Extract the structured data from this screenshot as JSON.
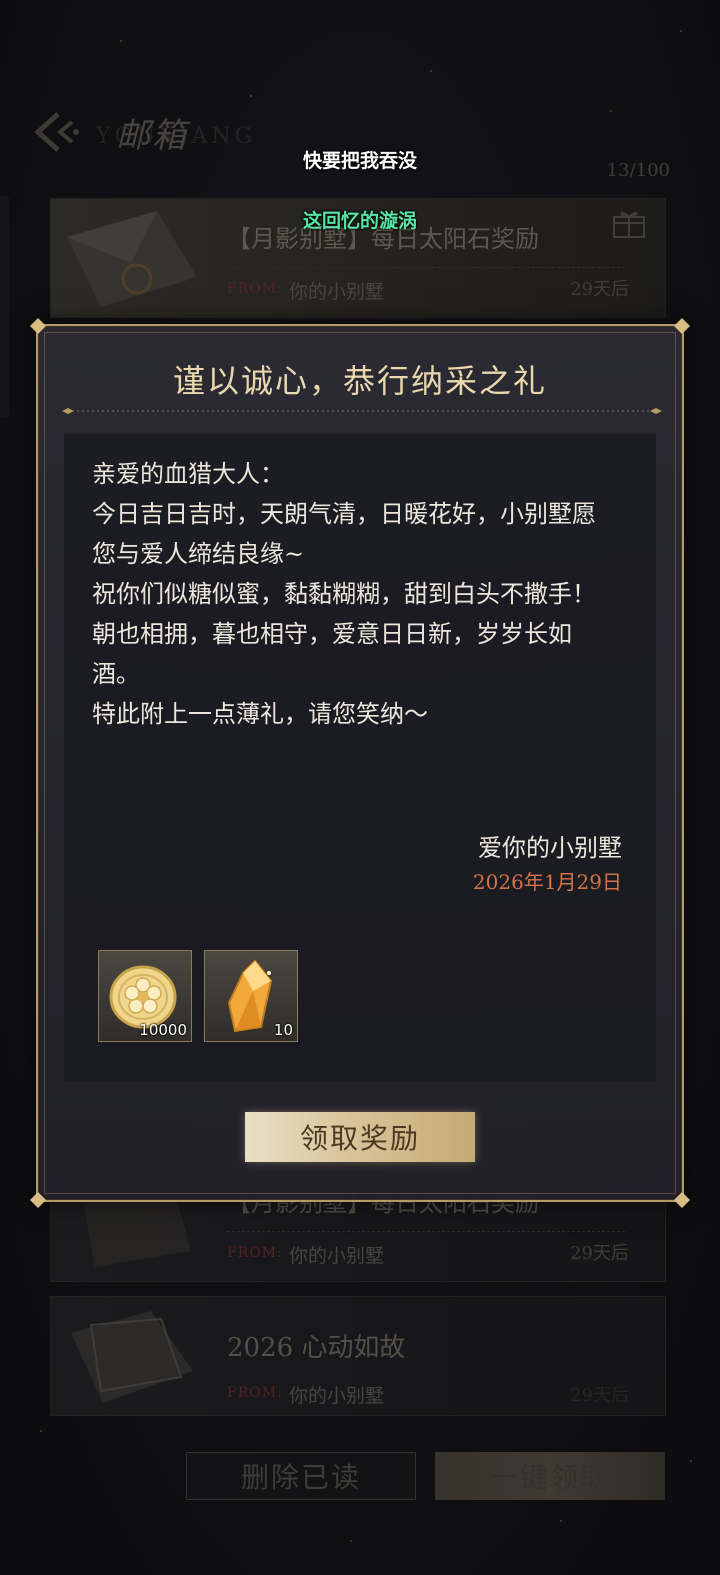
{
  "header": {
    "title": "邮箱",
    "title_en": "YOUXIANG",
    "mail_count": "13/100"
  },
  "toast": {
    "line1": "快要把我吞没",
    "line2": "这回忆的漩涡"
  },
  "mail_list": [
    {
      "title": "【月影别墅】每日太阳石奖励",
      "from_label": "FROM:",
      "from": "你的小别墅",
      "expire": "29天后"
    },
    {
      "title": "【月影别墅】每日太阳石奖励",
      "from_label": "FROM:",
      "from": "你的小别墅",
      "expire": "29天后"
    },
    {
      "title": "2026 心动如故",
      "from_label": "FROM:",
      "from": "你的小别墅",
      "expire": "29天后"
    }
  ],
  "bottom_bar": {
    "delete_read": "删除已读",
    "claim_all": "一键领取"
  },
  "modal": {
    "title": "谨以诚心，恭行纳采之礼",
    "letter_lines": [
      "亲爱的血猎大人：",
      "今日吉日吉时，天朗气清，日暖花好，小别墅愿",
      "您与爱人缔结良缘~",
      "祝你们似糖似蜜，黏黏糊糊，甜到白头不撒手！",
      "朝也相拥，暮也相守，爱意日日新，岁岁长如",
      "酒。",
      "特此附上一点薄礼，请您笑纳～"
    ],
    "signature": "爱你的小别墅",
    "date": "2026年1月29日",
    "rewards": [
      {
        "icon": "gold-coin-icon",
        "count": "10000"
      },
      {
        "icon": "sun-crystal-icon",
        "count": "10"
      }
    ],
    "claim_button": "领取奖励"
  },
  "colors": {
    "gold_border": "#b89a63",
    "title_gold": "#e9d7ad",
    "date_orange": "#d4734a",
    "toast_green": "#57e6a6"
  }
}
